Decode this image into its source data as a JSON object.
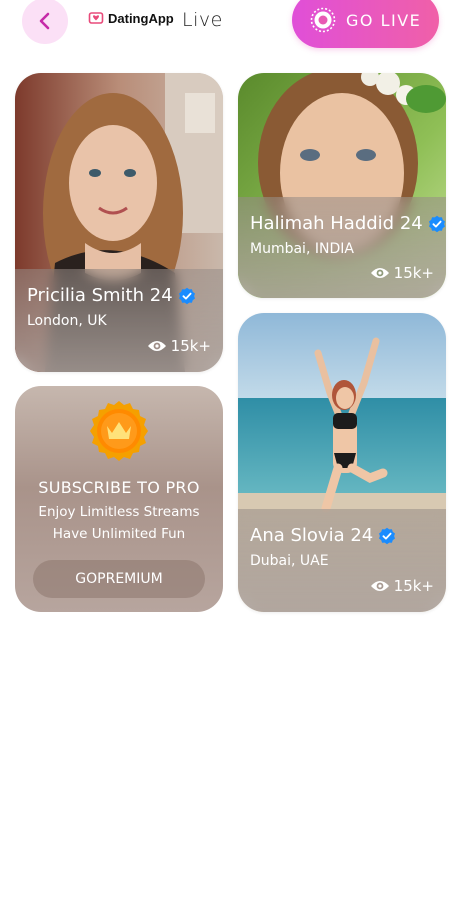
{
  "header": {
    "logo_text": "DatingApp",
    "live_label": "Live",
    "go_live_label": "GO LIVE"
  },
  "streams": [
    {
      "name": "Pricilia Smith 24",
      "location": "London, UK",
      "views": "15k+"
    },
    {
      "name": "Halimah Haddid 24",
      "location": "Mumbai, INDIA",
      "views": "15k+"
    },
    {
      "name": "Ana Slovia 24",
      "location": "Dubai, UAE",
      "views": "15k+"
    }
  ],
  "promo": {
    "title": "SUBSCRIBE TO PRO",
    "line1": "Enjoy Limitless Streams",
    "line2": "Have Unlimited Fun",
    "button": "GOPREMIUM"
  },
  "colors": {
    "accent_pink": "#e04fd8",
    "verified_blue": "#1a8cff",
    "badge_orange": "#f5a000"
  },
  "icons": [
    "back-icon",
    "dating-app-logo-icon",
    "live-broadcast-icon",
    "verified-badge-icon",
    "eye-icon",
    "crown-icon"
  ]
}
